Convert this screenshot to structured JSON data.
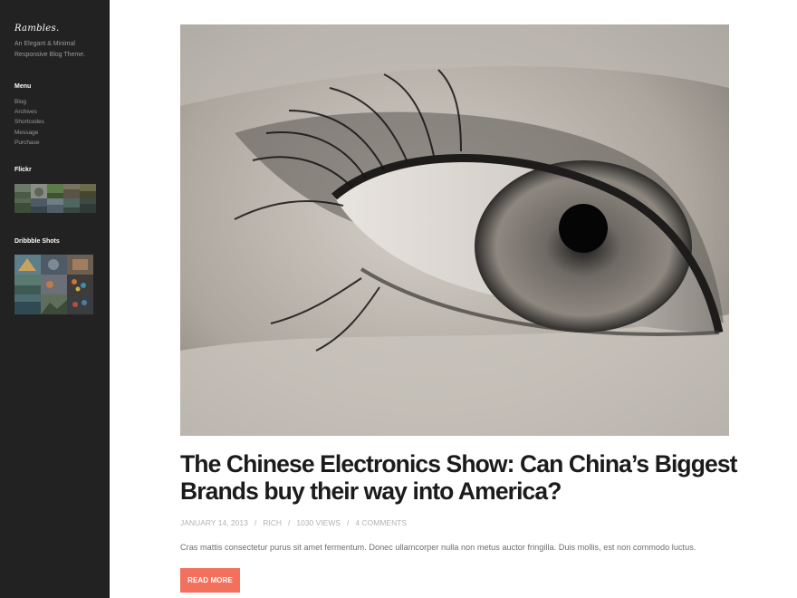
{
  "sidebar": {
    "logo": "Rambles.",
    "tagline_line1": "An Elegant & Minimal",
    "tagline_line2": "Responsive Blog Theme.",
    "menu_title": "Menu",
    "menu_items": [
      {
        "label": "Blog"
      },
      {
        "label": "Archives"
      },
      {
        "label": "Shortcodes"
      },
      {
        "label": "Message"
      },
      {
        "label": "Purchase"
      }
    ],
    "flickr_title": "Flickr",
    "dribbble_title": "Dribbble Shots"
  },
  "post": {
    "title": "The Chinese Electronics Show: Can China’s Biggest Brands buy their way into America?",
    "date": "JANUARY 14, 2013",
    "author": "RICH",
    "views": "1030 VIEWS",
    "comments": "4 COMMENTS",
    "separator": "/",
    "excerpt": "Cras mattis consectetur purus sit amet fermentum. Donec ullamcorper nulla non metus auctor fringilla. Duis mollis, est non commodo luctus.",
    "read_more": "READ MORE"
  },
  "colors": {
    "sidebar_bg": "#222222",
    "accent": "#f2705c",
    "title_text": "#1b1b1b",
    "meta_text": "#b3b3b3"
  },
  "icons": {
    "hero_image": "eye-photo",
    "flickr_thumbnails": "landscape-photo-thumbnails",
    "dribbble_thumbnails": "artwork-thumbnails"
  }
}
